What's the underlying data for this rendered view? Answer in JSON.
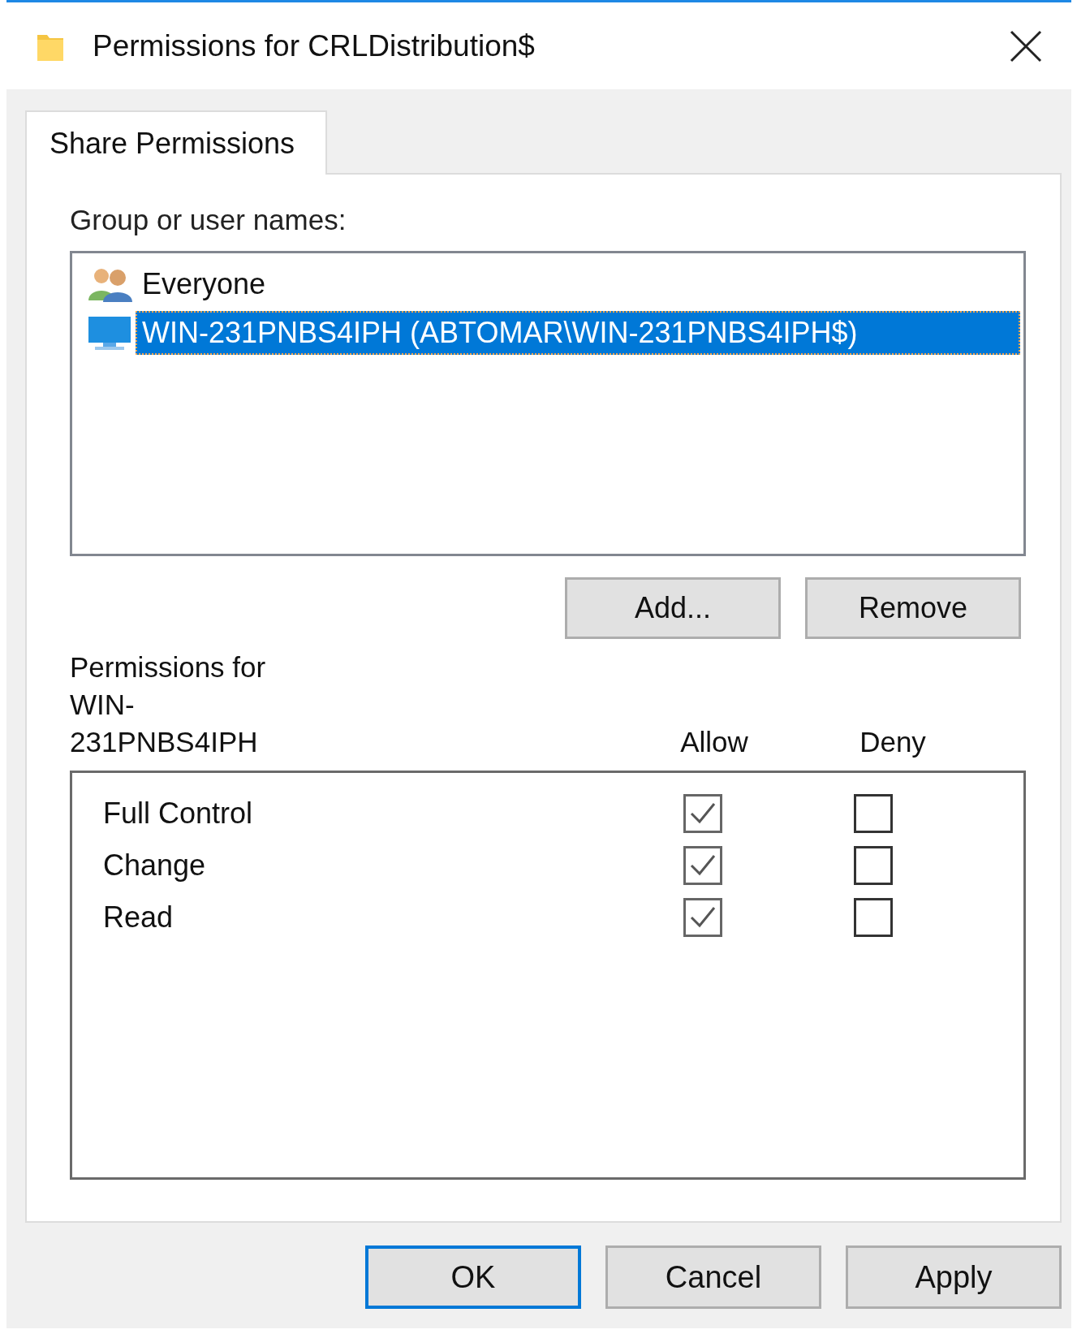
{
  "window": {
    "title": "Permissions for CRLDistribution$"
  },
  "tabs": [
    {
      "label": "Share Permissions",
      "selected": true
    }
  ],
  "group_label": "Group or user names:",
  "principals": [
    {
      "name": "Everyone",
      "kind": "group",
      "selected": false
    },
    {
      "name": "WIN-231PNBS4IPH (ABTOMAR\\WIN-231PNBS4IPH$)",
      "kind": "computer",
      "selected": true
    }
  ],
  "list_buttons": [
    "Add...",
    "Remove"
  ],
  "permissions_label": "Permissions for WIN-231PNBS4IPH",
  "columns": [
    "Allow",
    "Deny"
  ],
  "permissions": [
    {
      "name": "Full Control",
      "allow": true,
      "deny": false
    },
    {
      "name": "Change",
      "allow": true,
      "deny": false
    },
    {
      "name": "Read",
      "allow": true,
      "deny": false
    }
  ],
  "buttons": [
    {
      "label": "OK",
      "default": true
    },
    {
      "label": "Cancel",
      "default": false
    },
    {
      "label": "Apply",
      "default": false
    }
  ]
}
